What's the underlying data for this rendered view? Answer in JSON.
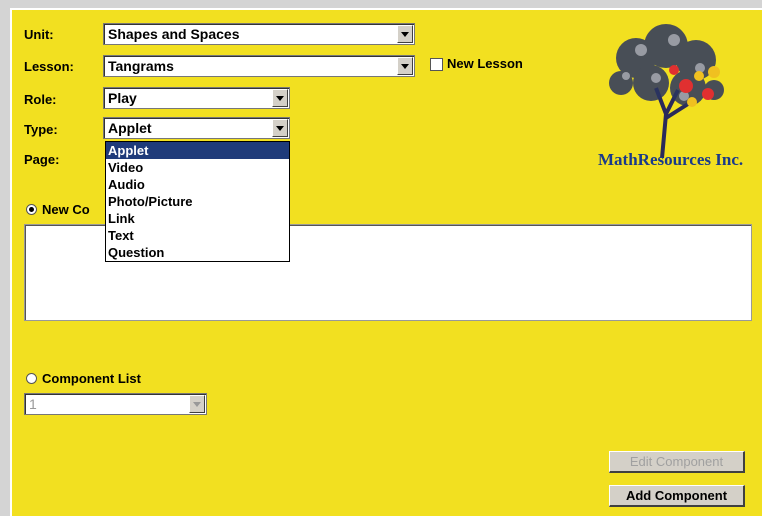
{
  "form": {
    "unit_label": "Unit:",
    "unit_value": "Shapes and Spaces",
    "lesson_label": "Lesson:",
    "lesson_value": "Tangrams",
    "new_lesson_label": "New Lesson",
    "role_label": "Role:",
    "role_value": "Play",
    "type_label": "Type:",
    "type_value": "Applet",
    "page_label": "Page:"
  },
  "type_dropdown": {
    "options": [
      "Applet",
      "Video",
      "Audio",
      "Photo/Picture",
      "Link",
      "Text",
      "Question"
    ],
    "selected": "Applet"
  },
  "component": {
    "new_component_label": "New Co",
    "new_component_selected": true,
    "component_list_label": "Component List",
    "component_list_value": "1"
  },
  "buttons": {
    "edit_component": "Edit Component",
    "add_component": "Add Component"
  },
  "logo": {
    "company": "MathResources Inc."
  },
  "colors": {
    "background": "#f2e020",
    "selection": "#1f3b7a",
    "logo_text": "#1a3a8a"
  }
}
